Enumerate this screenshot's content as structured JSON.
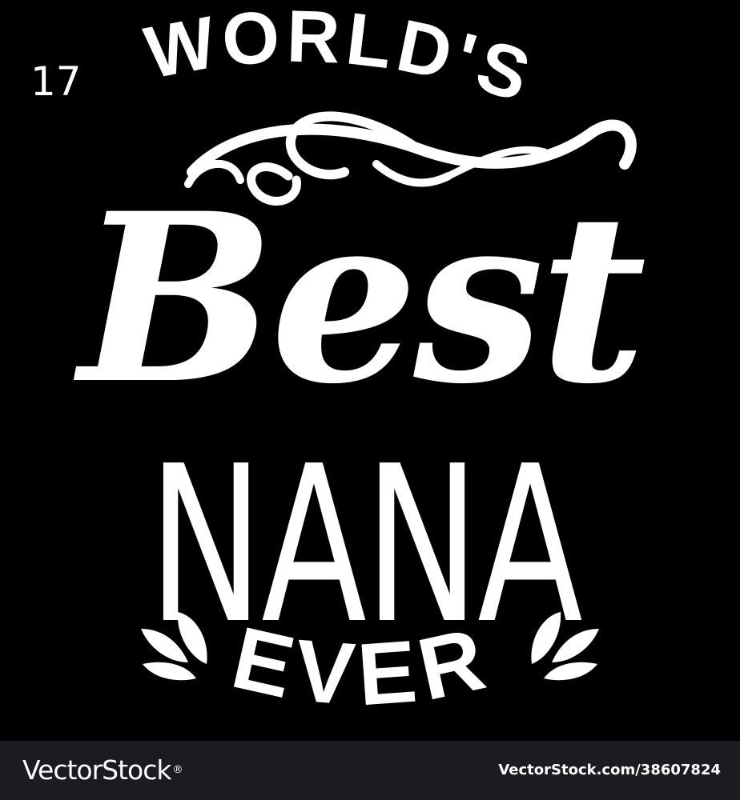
{
  "page_number": "17",
  "artwork": {
    "line1": "WORLD'S",
    "line2": "Best",
    "line3": "NANA",
    "line4": "EVER"
  },
  "footer": {
    "brand": "VectorStock",
    "registered_mark": "®",
    "image_id": "VectorStock.com/38607824"
  },
  "colors": {
    "background": "#000000",
    "text": "#ffffff",
    "footer_bar": "#1a1c21"
  }
}
